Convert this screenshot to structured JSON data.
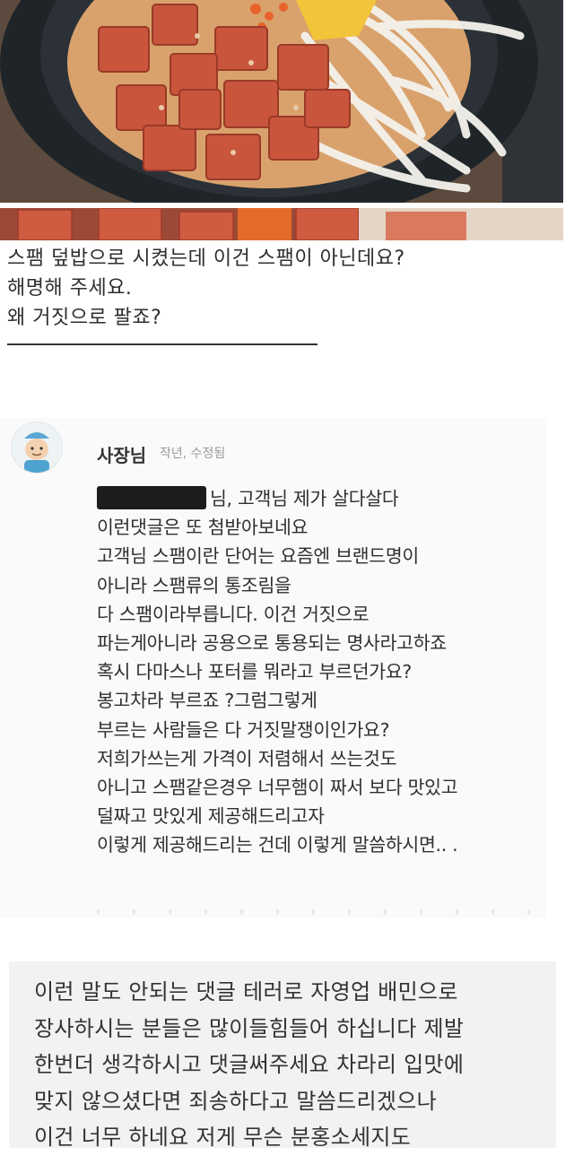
{
  "review": {
    "lines": [
      "스팸 덮밥으로 시켰는데 이건 스팸이 아닌데요?",
      "해명해 주세요.",
      "왜 거짓으로 팔죠?"
    ]
  },
  "reply": {
    "author": "사장님",
    "meta": "작년, 수정됨",
    "first_line_visible": "님, 고객님 제가 살다살다",
    "lines": [
      "이런댓글은 또 첨받아보네요",
      "고객님 스팸이란 단어는 요즘엔 브랜드명이",
      "아니라 스팸류의 통조림을",
      "다 스팸이라부릅니다. 이건 거짓으로",
      "파는게아니라 공용으로 통용되는 명사라고하죠",
      "혹시 다마스나 포터를 뭐라고 부르던가요?",
      "봉고차라 부르죠 ?그럼그렇게",
      "부르는 사람들은 다 거짓말쟁이인가요?",
      "저희가쓰는게 가격이 저렴해서 쓰는것도",
      "아니고 스팸같은경우 너무햄이 짜서 보다 맛있고",
      "덜짜고 맛있게 제공해드리고자",
      "이렇게 제공해드리는 건데 이렇게 말씀하시면.. ."
    ]
  },
  "notice": {
    "lines": [
      "이런 말도 안되는 댓글 테러로 자영업 배민으로",
      "장사하시는 분들은 많이들힘들어 하십니다 제발",
      "한번더 생각하시고 댓글써주세요 차라리 입맛에",
      "맞지 않으셨다면 죄송하다고 말씀드리겠으나",
      "이건 너무 하네요  저게 무슨 분홍소세지도"
    ]
  },
  "colors": {
    "spam": "#c8553c",
    "onion": "#f2f0ea",
    "bowl": "#23282c",
    "card_bg": "#fbfafa",
    "notice_bg": "#f2f2f2"
  },
  "icons": {
    "avatar": "owner-avatar-icon"
  }
}
